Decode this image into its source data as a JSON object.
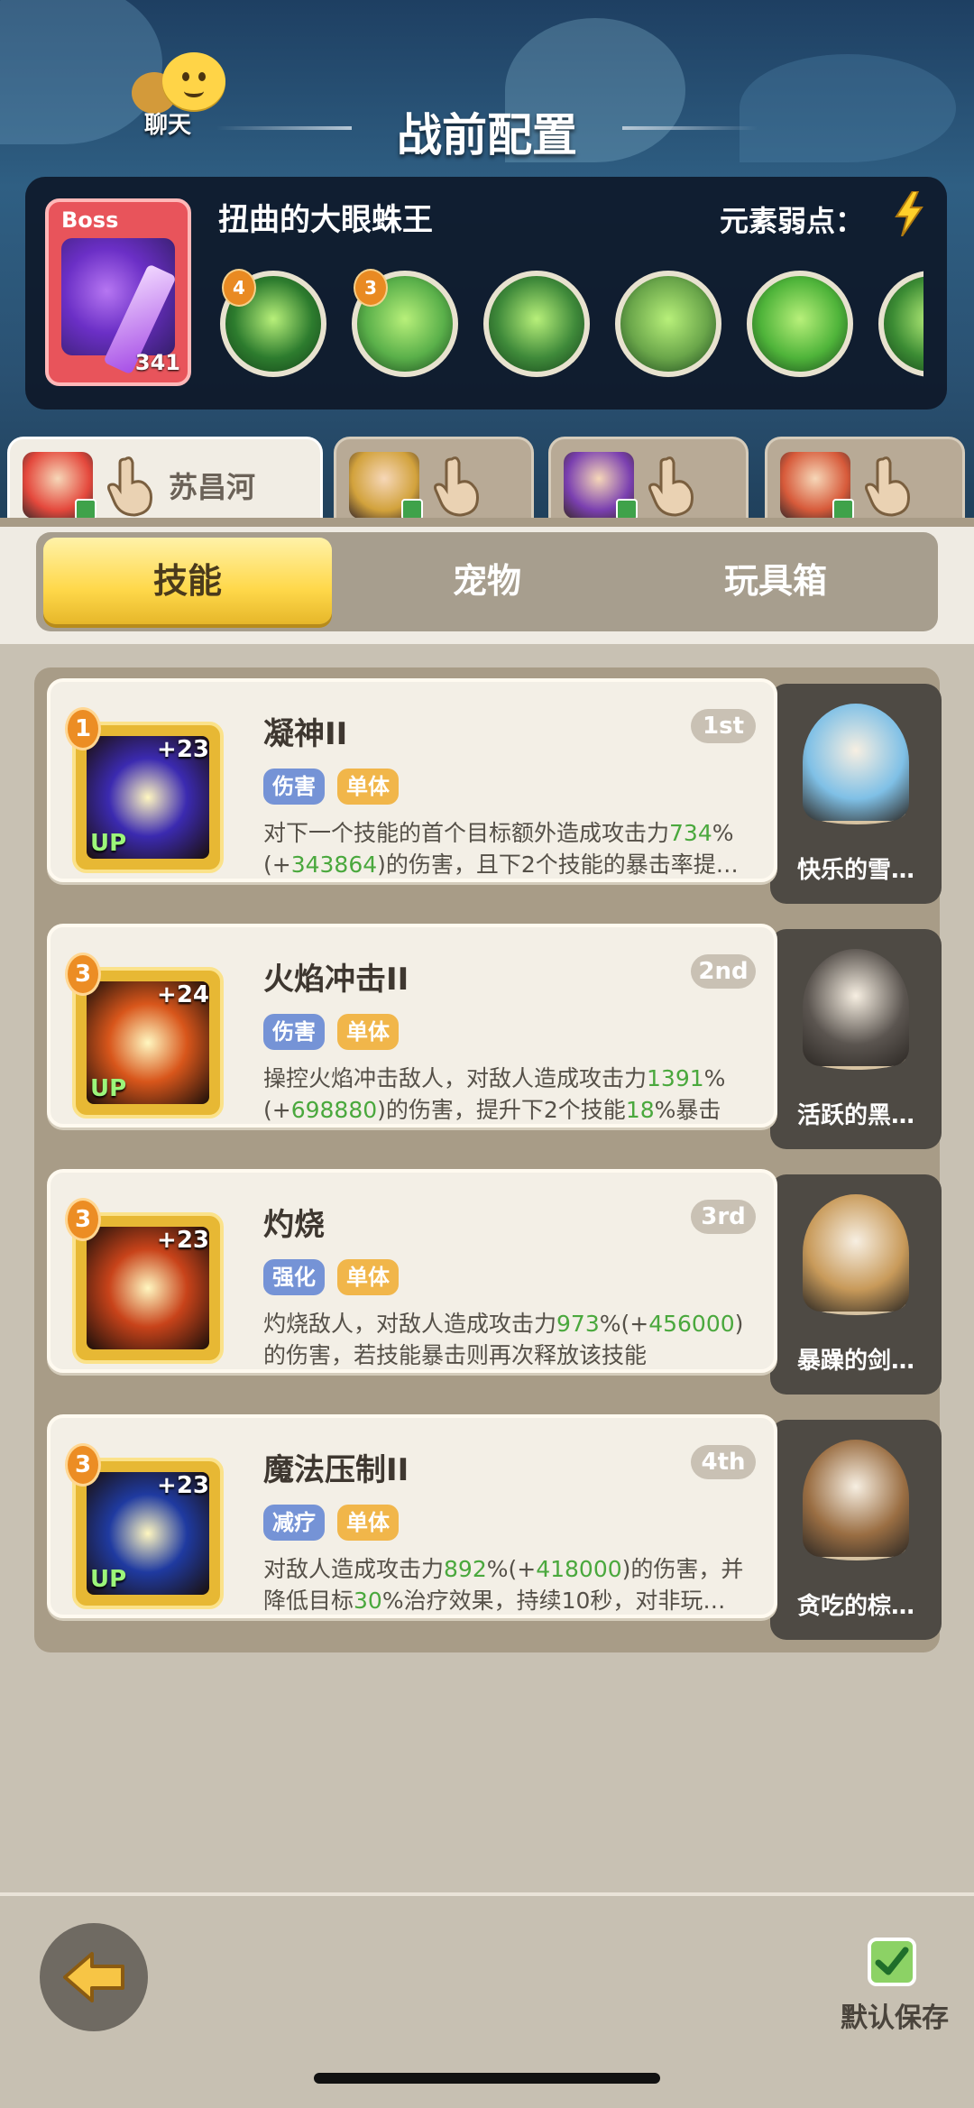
{
  "header": {
    "chat_label": "聊天",
    "title": "战前配置"
  },
  "boss": {
    "tag": "Boss",
    "level": "341",
    "name": "扭曲的大眼蛛王",
    "weakness_label": "元素弱点：",
    "weakness_icon": "lightning-icon",
    "skills": [
      {
        "badge": "4",
        "icon": "green-slash-icon",
        "color": "#2d7c2e"
      },
      {
        "badge": "3",
        "icon": "spider-web-icon",
        "color": "#5ab04a"
      },
      {
        "badge": "",
        "icon": "beetle-mask-icon",
        "color": "#3f8a3a"
      },
      {
        "badge": "",
        "icon": "boar-warrior-icon",
        "color": "#6aa64a"
      },
      {
        "badge": "",
        "icon": "green-slime-icon",
        "color": "#4fb43a"
      },
      {
        "badge": "",
        "icon": "green-skill-icon",
        "color": "#3c8c34"
      }
    ]
  },
  "hero_tabs": [
    {
      "name": "苏昌河",
      "active": true
    },
    {
      "name": "",
      "active": false
    },
    {
      "name": "",
      "active": false
    },
    {
      "name": "",
      "active": false
    }
  ],
  "categories": [
    "技能",
    "宠物",
    "玩具箱"
  ],
  "skills": [
    {
      "level": "1",
      "plus": "+23",
      "up": "UP",
      "title": "凝神II",
      "rank": "1st",
      "tags": [
        "伤害",
        "单体"
      ],
      "desc_parts": [
        "对下一个技能的首个目标额外造成攻击力",
        "734",
        "%(+",
        "343864",
        ")的伤害，且下2个技能的暴击率提…"
      ],
      "pet_name": "快乐的雪…",
      "icon_color": "#3b2ab0",
      "pet_color": "#7fc0e6"
    },
    {
      "level": "3",
      "plus": "+24",
      "up": "UP",
      "title": "火焰冲击II",
      "rank": "2nd",
      "tags": [
        "伤害",
        "单体"
      ],
      "desc_parts": [
        "操控火焰冲击敌人，对敌人造成攻击力",
        "1391",
        "%(+",
        "698880",
        ")的伤害，提升下2个技能",
        "18",
        "%暴击几…"
      ],
      "pet_name": "活跃的黑…",
      "icon_color": "#d8561b",
      "pet_color": "#5b5550"
    },
    {
      "level": "3",
      "plus": "+23",
      "up": "",
      "title": "灼烧",
      "rank": "3rd",
      "tags": [
        "强化",
        "单体"
      ],
      "desc_parts": [
        "灼烧敌人，对敌人造成攻击力",
        "973",
        "%(+",
        "456000",
        ")的伤害，若技能暴击则再次释放该技能"
      ],
      "pet_name": "暴躁的剑…",
      "icon_color": "#c8431a",
      "pet_color": "#c89a5a"
    },
    {
      "level": "3",
      "plus": "+23",
      "up": "UP",
      "title": "魔法压制II",
      "rank": "4th",
      "tags": [
        "减疗",
        "单体"
      ],
      "desc_parts": [
        "对敌人造成攻击力",
        "892",
        "%(+",
        "418000",
        ")的伤害，并降低目标",
        "30",
        "%治疗效果，持续10秒，对非玩…"
      ],
      "pet_name": "贪吃的棕…",
      "icon_color": "#1f3aa0",
      "pet_color": "#9a6e43"
    }
  ],
  "footer": {
    "save_label": "默认保存"
  }
}
